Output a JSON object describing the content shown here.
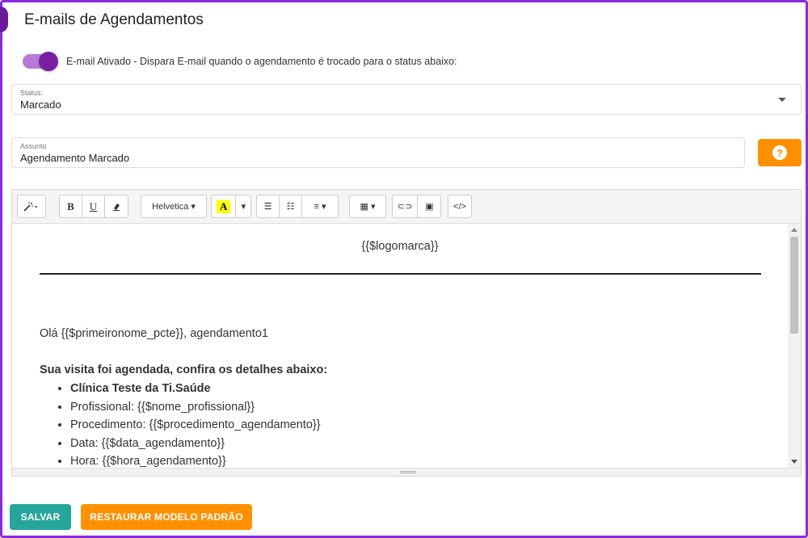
{
  "page": {
    "title": "E-mails de Agendamentos"
  },
  "toggle": {
    "label": "E-mail Ativado - Dispara E-mail quando o agendamento é trocado para o status abaixo:",
    "checked": true
  },
  "status": {
    "label": "Status:",
    "value": "Marcado"
  },
  "subject": {
    "label": "Assunto",
    "value": "Agendamento Marcado"
  },
  "help_button": {
    "icon": "question-circle-icon",
    "label": "?"
  },
  "toolbar": {
    "style_icon": "magic-wand-icon",
    "bold": "B",
    "underline": "U",
    "eraser_icon": "eraser-icon",
    "font_name": "Helvetica ▾",
    "highlight": "A",
    "caret": "▾",
    "unordered_list_icon": "☰",
    "ordered_list_icon": "☷",
    "align_icon": "≡ ▾",
    "table_icon": "▦ ▾",
    "link_icon": "⊂⊃",
    "image_icon": "▣",
    "code_icon": "</>"
  },
  "editor": {
    "logo_placeholder": "{{$logomarca}}",
    "greeting": "Olá {{$primeironome_pcte}}, agendamento1",
    "visit_title": "Sua visita foi agendada, confira os detalhes abaixo:",
    "details": [
      "Clínica Teste da Ti.Saúde",
      "Profissional: {{$nome_profissional}}",
      "Procedimento: {{$procedimento_agendamento}}",
      "Data: {{$data_agendamento}}",
      "Hora: {{$hora_agendamento}}"
    ]
  },
  "actions": {
    "save": "SALVAR",
    "restore": "RESTAURAR MODELO PADRÃO"
  },
  "colors": {
    "accent_purple": "#7b1fa2",
    "orange": "#ff9100",
    "teal": "#26a69a",
    "frame": "#8a2be2"
  }
}
